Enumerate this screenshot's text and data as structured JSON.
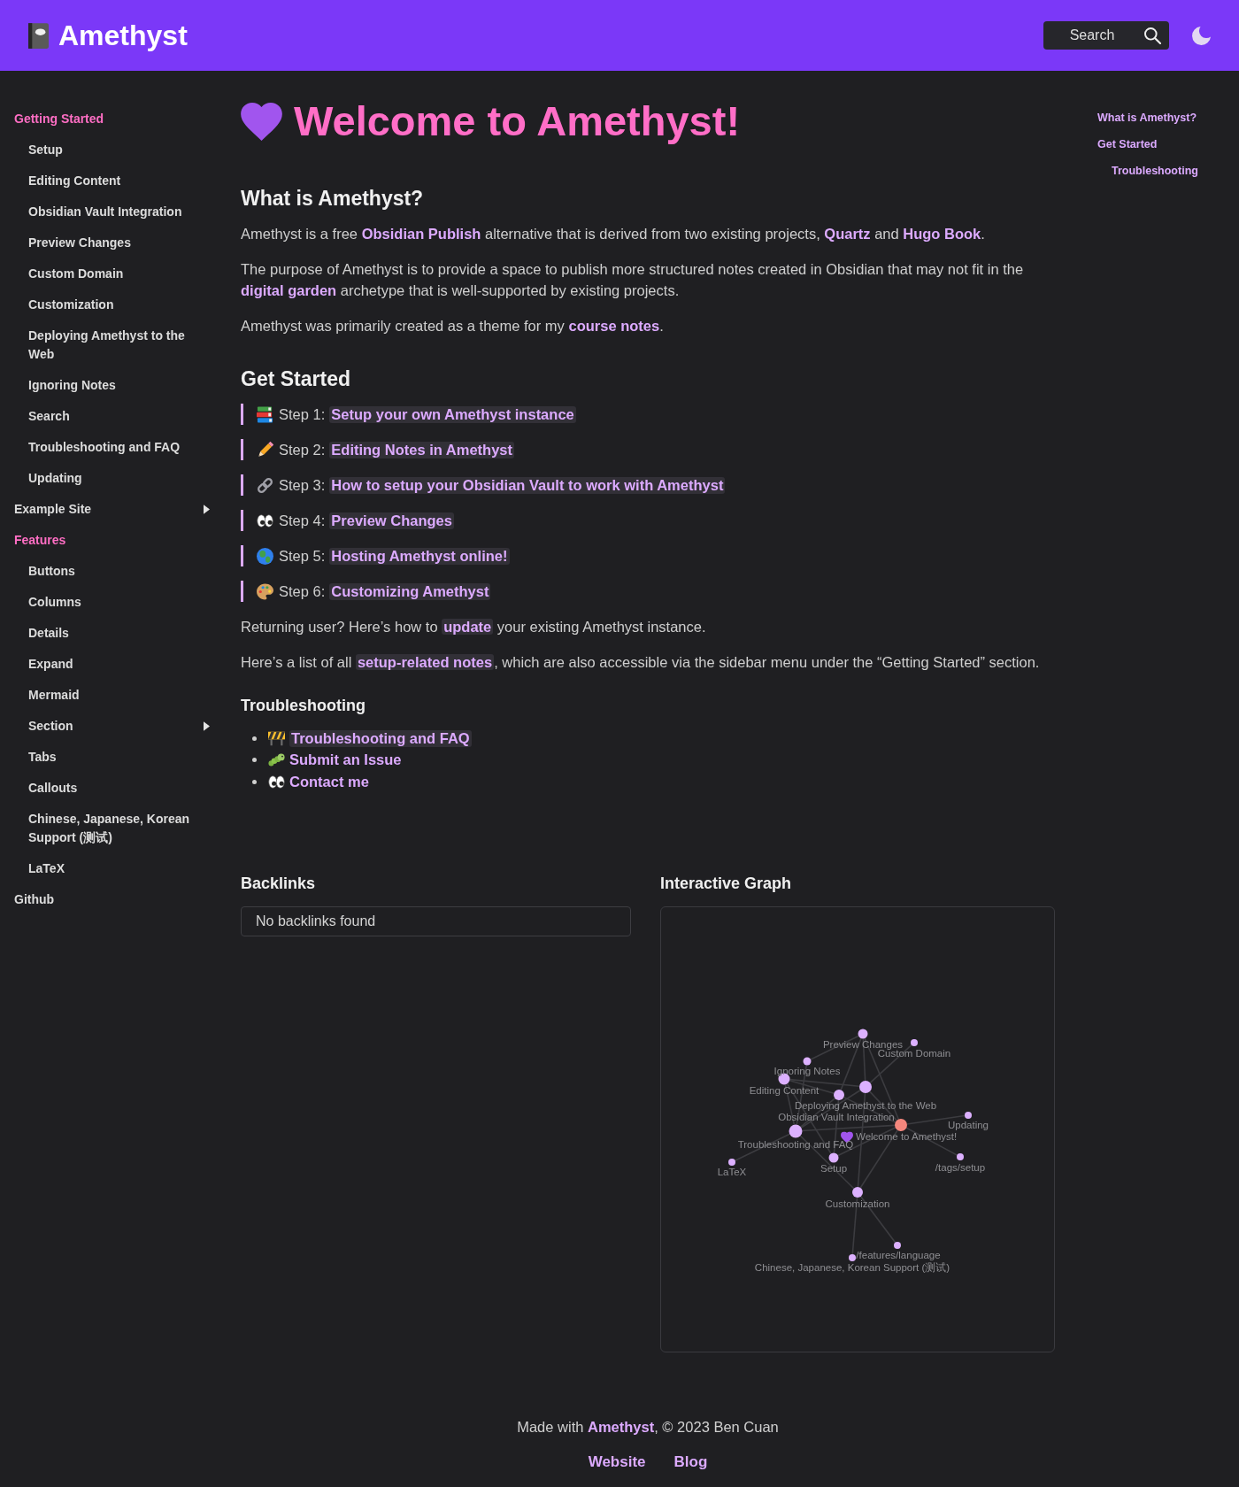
{
  "header": {
    "title": "Amethyst",
    "search": {
      "placeholder": "Search"
    }
  },
  "sidebar": {
    "items": [
      {
        "kind": "heading",
        "label": "Getting Started",
        "children": [
          {
            "kind": "page",
            "label": "Setup"
          },
          {
            "kind": "page",
            "label": "Editing Content"
          },
          {
            "kind": "page",
            "label": "Obsidian Vault Integration"
          },
          {
            "kind": "page",
            "label": "Preview Changes"
          },
          {
            "kind": "page",
            "label": "Custom Domain"
          },
          {
            "kind": "page",
            "label": "Customization"
          },
          {
            "kind": "page",
            "label": "Deploying Amethyst to the Web"
          },
          {
            "kind": "page",
            "label": "Ignoring Notes"
          },
          {
            "kind": "page",
            "label": "Search"
          },
          {
            "kind": "page",
            "label": "Troubleshooting and FAQ"
          },
          {
            "kind": "page",
            "label": "Updating"
          }
        ]
      },
      {
        "kind": "collapsible",
        "label": "Example Site",
        "expanded": false
      },
      {
        "kind": "heading",
        "label": "Features",
        "children": [
          {
            "kind": "page",
            "label": "Buttons"
          },
          {
            "kind": "page",
            "label": "Columns"
          },
          {
            "kind": "page",
            "label": "Details"
          },
          {
            "kind": "page",
            "label": "Expand"
          },
          {
            "kind": "page",
            "label": "Mermaid"
          },
          {
            "kind": "collapsible",
            "label": "Section",
            "expanded": false
          },
          {
            "kind": "page",
            "label": "Tabs"
          },
          {
            "kind": "page",
            "label": "Callouts"
          },
          {
            "kind": "page",
            "label": "Chinese, Japanese, Korean Support (测试)"
          },
          {
            "kind": "page",
            "label": "LaTeX"
          }
        ]
      },
      {
        "kind": "page",
        "label": "Github"
      }
    ]
  },
  "article": {
    "title": "Welcome to Amethyst!",
    "blocks": [
      {
        "kind": "h2",
        "text": "What is Amethyst?"
      },
      {
        "kind": "paragraph",
        "parts": [
          {
            "kind": "text",
            "text": "Amethyst is a free "
          },
          {
            "kind": "link",
            "text": "Obsidian Publish"
          },
          {
            "kind": "text",
            "text": " alternative that is derived from two existing projects, "
          },
          {
            "kind": "link",
            "text": "Quartz"
          },
          {
            "kind": "text",
            "text": " and "
          },
          {
            "kind": "link",
            "text": "Hugo Book"
          },
          {
            "kind": "text",
            "text": "."
          }
        ]
      },
      {
        "kind": "paragraph",
        "parts": [
          {
            "kind": "text",
            "text": "The purpose of Amethyst is to provide a space to publish more structured notes created in Obsidian that may not fit in the "
          },
          {
            "kind": "link",
            "text": "digital garden"
          },
          {
            "kind": "text",
            "text": " archetype that is well-supported by existing projects."
          }
        ]
      },
      {
        "kind": "paragraph",
        "parts": [
          {
            "kind": "text",
            "text": "Amethyst was primarily created as a theme for my "
          },
          {
            "kind": "link",
            "text": "course notes"
          },
          {
            "kind": "text",
            "text": "."
          }
        ]
      },
      {
        "kind": "h2",
        "text": "Get Started"
      },
      {
        "kind": "steps",
        "items": [
          {
            "label": "Step 1:",
            "link": "Setup your own Amethyst instance"
          },
          {
            "label": "Step 2:",
            "link": "Editing Notes in Amethyst"
          },
          {
            "label": "Step 3:",
            "link": "How to setup your Obsidian Vault to work with Amethyst"
          },
          {
            "label": "Step 4:",
            "link": "Preview Changes"
          },
          {
            "label": "Step 5:",
            "link": "Hosting Amethyst online!"
          },
          {
            "label": "Step 6:",
            "link": "Customizing Amethyst"
          }
        ]
      },
      {
        "kind": "paragraph",
        "parts": [
          {
            "kind": "text",
            "text": "Returning user? Here’s how to "
          },
          {
            "kind": "internal-link",
            "text": "update"
          },
          {
            "kind": "text",
            "text": " your existing Amethyst instance."
          }
        ]
      },
      {
        "kind": "paragraph",
        "parts": [
          {
            "kind": "text",
            "text": "Here’s a list of all "
          },
          {
            "kind": "internal-link",
            "text": "setup-related notes"
          },
          {
            "kind": "text",
            "text": ", which are also accessible via the sidebar menu under the “Getting Started” section."
          }
        ]
      },
      {
        "kind": "h3",
        "text": "Troubleshooting"
      },
      {
        "kind": "list",
        "items": [
          {
            "kind": "internal-link",
            "text": "Troubleshooting and FAQ"
          },
          {
            "kind": "link",
            "text": "Submit an Issue"
          },
          {
            "kind": "link",
            "text": "Contact me"
          }
        ]
      }
    ]
  },
  "toc": {
    "items": [
      {
        "label": "What is Amethyst?"
      },
      {
        "label": "Get Started",
        "children": [
          {
            "label": "Troubleshooting"
          }
        ]
      }
    ]
  },
  "backlinks": {
    "title": "Backlinks",
    "message": "No backlinks found"
  },
  "graph": {
    "title": "Interactive Graph",
    "nodes": [
      {
        "label": "Preview Changes",
        "current": false
      },
      {
        "label": "Custom Domain",
        "current": false
      },
      {
        "label": "Ignoring Notes",
        "current": false
      },
      {
        "label": "Editing Content",
        "current": false
      },
      {
        "label": "Deploying Amethyst to the Web",
        "current": false
      },
      {
        "label": "Obsidian Vault Integration",
        "current": false
      },
      {
        "label": "Updating",
        "current": false
      },
      {
        "label": "Welcome to Amethyst!",
        "current": true
      },
      {
        "label": "Troubleshooting and FAQ",
        "current": false
      },
      {
        "label": "LaTeX",
        "current": false
      },
      {
        "label": "Setup",
        "current": false
      },
      {
        "label": "/tags/setup",
        "current": false
      },
      {
        "label": "Customization",
        "current": false
      },
      {
        "label": "/features/language",
        "current": false
      },
      {
        "label": "Chinese, Japanese, Korean Support (测试)",
        "current": false
      }
    ]
  },
  "footer": {
    "credit": [
      {
        "kind": "text",
        "text": "Made with "
      },
      {
        "kind": "link",
        "text": "Amethyst"
      },
      {
        "kind": "text",
        "text": ", © 2023 Ben Cuan"
      }
    ],
    "links": [
      "Website",
      "Blog"
    ]
  }
}
